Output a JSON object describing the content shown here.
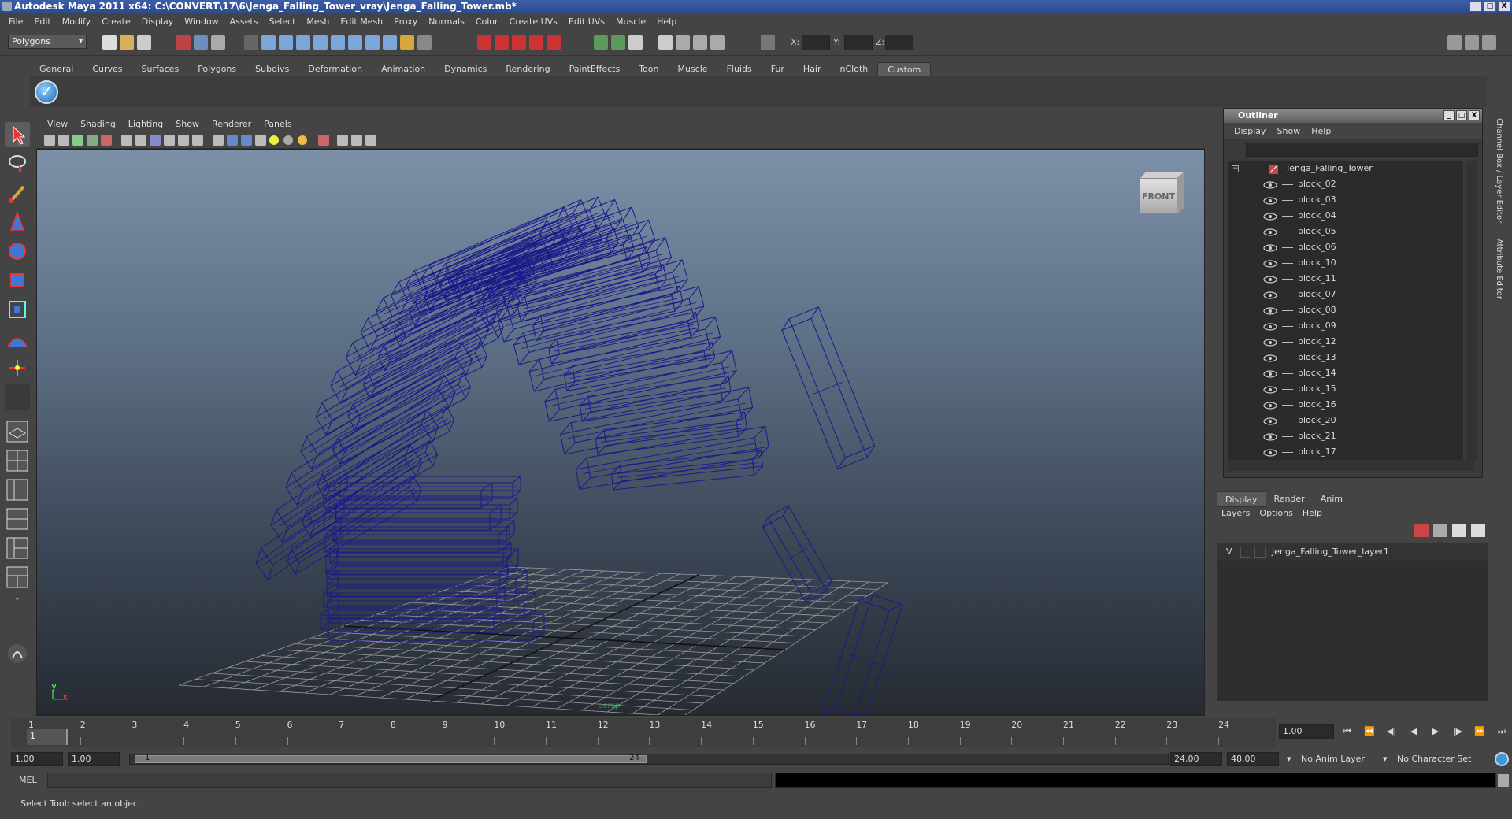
{
  "window": {
    "title": "Autodesk Maya 2011 x64: C:\\CONVERT\\17\\6\\Jenga_Falling_Tower_vray\\Jenga_Falling_Tower.mb*",
    "min": "_",
    "max": "□",
    "close": "X"
  },
  "menubar": [
    "File",
    "Edit",
    "Modify",
    "Create",
    "Display",
    "Window",
    "Assets",
    "Select",
    "Mesh",
    "Edit Mesh",
    "Proxy",
    "Normals",
    "Color",
    "Create UVs",
    "Edit UVs",
    "Muscle",
    "Help"
  ],
  "statusline": {
    "menuset": "Polygons",
    "x_label": "X:",
    "y_label": "Y:",
    "z_label": "Z:"
  },
  "shelf": {
    "tabs": [
      "General",
      "Curves",
      "Surfaces",
      "Polygons",
      "Subdivs",
      "Deformation",
      "Animation",
      "Dynamics",
      "Rendering",
      "PaintEffects",
      "Toon",
      "Muscle",
      "Fluids",
      "Fur",
      "Hair",
      "nCloth",
      "Custom"
    ],
    "active_tab": "Custom",
    "check": "✓"
  },
  "viewport": {
    "menu": [
      "View",
      "Shading",
      "Lighting",
      "Show",
      "Renderer",
      "Panels"
    ],
    "viewcube_label": "FRONT",
    "axis_y": "y",
    "axis_x": "x",
    "camera_label": "persp"
  },
  "outliner": {
    "title": "Outliner",
    "menu": [
      "Display",
      "Show",
      "Help"
    ],
    "root": "Jenga_Falling_Tower",
    "items": [
      "block_02",
      "block_03",
      "block_04",
      "block_05",
      "block_06",
      "block_10",
      "block_11",
      "block_07",
      "block_08",
      "block_09",
      "block_12",
      "block_13",
      "block_14",
      "block_15",
      "block_16",
      "block_20",
      "block_21",
      "block_17"
    ]
  },
  "layer_editor": {
    "tabs": [
      "Display",
      "Render",
      "Anim"
    ],
    "active_tab": "Display",
    "menu": [
      "Layers",
      "Options",
      "Help"
    ],
    "layer_visible": "V",
    "layer_name": "Jenga_Falling_Tower_layer1"
  },
  "side_tabs": [
    "Channel Box / Layer Editor",
    "Attribute Editor"
  ],
  "timeline": {
    "frames": [
      "1",
      "2",
      "3",
      "4",
      "5",
      "6",
      "7",
      "8",
      "9",
      "10",
      "11",
      "12",
      "13",
      "14",
      "15",
      "16",
      "17",
      "18",
      "19",
      "20",
      "21",
      "22",
      "23",
      "24"
    ],
    "current_frame_marker": "1",
    "current_time": "1.00"
  },
  "range": {
    "start": "1.00",
    "playback_start": "1.00",
    "slider_start": "1",
    "slider_end": "24",
    "playback_end": "24.00",
    "end": "48.00",
    "anim_layer": "No Anim Layer",
    "char_set": "No Character Set"
  },
  "commandline": {
    "label": "MEL"
  },
  "helpline": {
    "text": "Select Tool: select an object"
  },
  "colors": {
    "wireframe": "#1a1a8a",
    "grid": "#9a9a9a",
    "accent": "#3d5fa8"
  }
}
